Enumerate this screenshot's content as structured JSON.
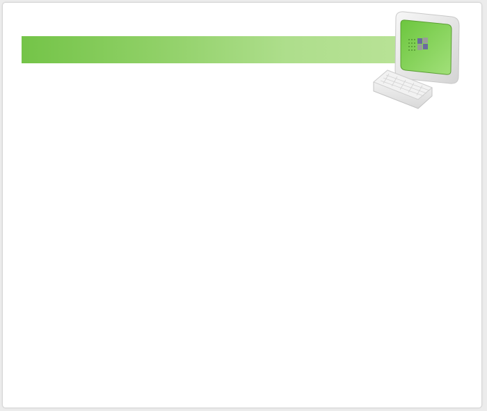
{
  "window": {
    "title": ""
  },
  "header": {
    "title": "",
    "gradient_start": "#74c448",
    "gradient_end": "#b8e296"
  },
  "icons": {
    "illustration": "computer-monitor-keyboard-icon"
  },
  "colors": {
    "background": "#ffffff",
    "page_background": "#ececec",
    "border": "#d6d6d6",
    "screen_green": "#8bd85a"
  }
}
